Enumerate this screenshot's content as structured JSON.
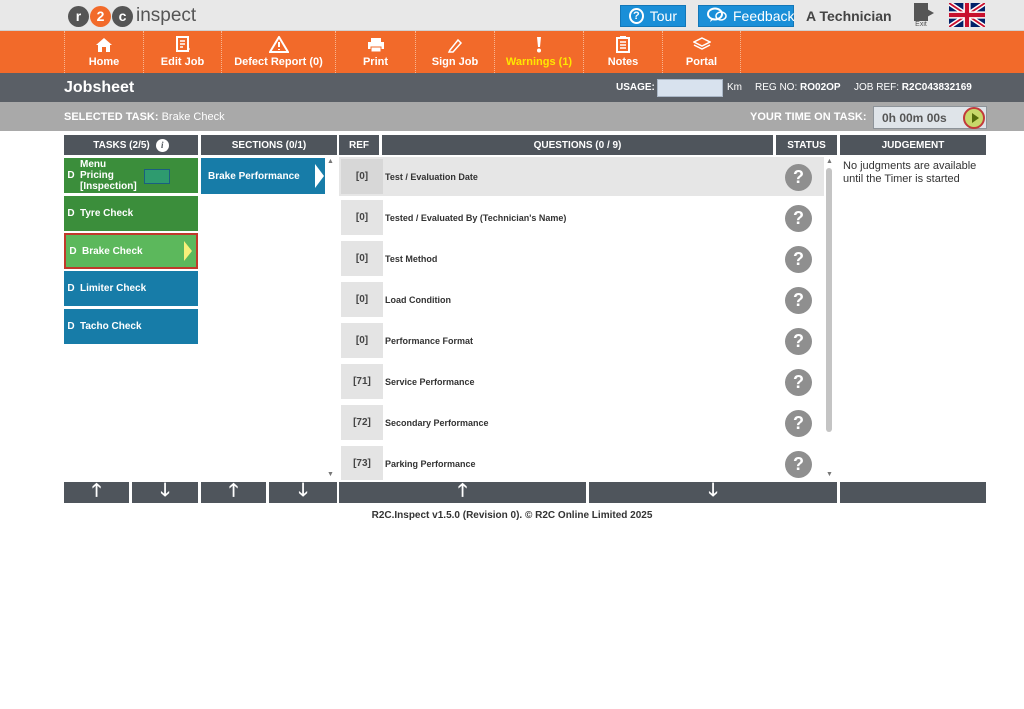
{
  "topbar": {
    "logo_mark": [
      "r",
      "2",
      "c"
    ],
    "logo_text": "inspect",
    "tour_label": "Tour",
    "feedback_label": "Feedback",
    "user_name": "A Technician",
    "exit_label": "Exit"
  },
  "nav": [
    {
      "label": "Home",
      "icon": "home-icon"
    },
    {
      "label": "Edit Job",
      "icon": "edit-job-icon"
    },
    {
      "label": "Defect Report (0)",
      "icon": "warning-triangle-icon"
    },
    {
      "label": "Print",
      "icon": "printer-icon"
    },
    {
      "label": "Sign Job",
      "icon": "pen-icon"
    },
    {
      "label": "Warnings (1)",
      "icon": "exclamation-icon"
    },
    {
      "label": "Notes",
      "icon": "notes-icon"
    },
    {
      "label": "Portal",
      "icon": "layers-icon"
    }
  ],
  "jobbar": {
    "title": "Jobsheet",
    "usage_label": "USAGE:",
    "usage_value": "",
    "km_label": "Km",
    "reg_label": "REG NO:",
    "reg_value": "RO02OP",
    "jobref_label": "JOB REF:",
    "jobref_value": "R2C043832169"
  },
  "taskbar": {
    "selected_label": "SELECTED TASK:",
    "selected_value": "Brake Check",
    "time_label": "YOUR TIME ON TASK:",
    "time_value": "0h 00m 00s"
  },
  "headers": {
    "tasks": "TASKS (2/5)",
    "sections": "SECTIONS (0/1)",
    "ref": "REF",
    "questions": "QUESTIONS (0 / 9)",
    "status": "STATUS",
    "judgement": "JUDGEMENT"
  },
  "tasks": [
    {
      "d": "D",
      "name": "Menu Pricing [Inspection]"
    },
    {
      "d": "D",
      "name": "Tyre Check"
    },
    {
      "d": "D",
      "name": "Brake Check"
    },
    {
      "d": "D",
      "name": "Limiter Check"
    },
    {
      "d": "D",
      "name": "Tacho Check"
    }
  ],
  "sections": [
    {
      "name": "Brake Performance"
    }
  ],
  "questions": [
    {
      "ref": "[0]",
      "text": "Test / Evaluation Date",
      "status": "?"
    },
    {
      "ref": "[0]",
      "text": "Tested / Evaluated By (Technician's Name)",
      "status": "?"
    },
    {
      "ref": "[0]",
      "text": "Test Method",
      "status": "?"
    },
    {
      "ref": "[0]",
      "text": "Load Condition",
      "status": "?"
    },
    {
      "ref": "[0]",
      "text": "Performance Format",
      "status": "?"
    },
    {
      "ref": "[71]",
      "text": "Service Performance",
      "status": "?"
    },
    {
      "ref": "[72]",
      "text": "Secondary Performance",
      "status": "?"
    },
    {
      "ref": "[73]",
      "text": "Parking Performance",
      "status": "?"
    }
  ],
  "judgement": {
    "message": "No judgments are available until the Timer is started"
  },
  "footer": {
    "text": "R2C.Inspect v1.5.0 (Revision 0). © R2C Online Limited 2025"
  }
}
